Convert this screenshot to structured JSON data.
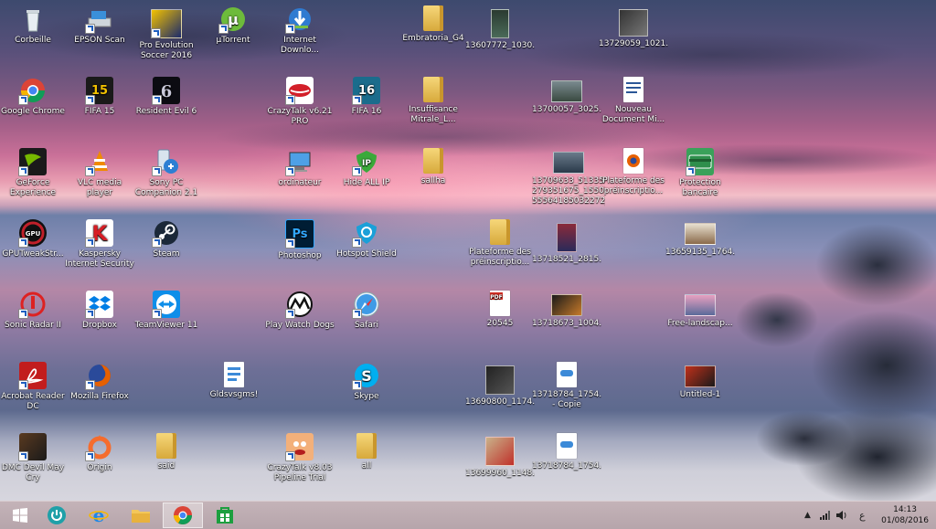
{
  "desktop": {
    "icons": {
      "recycle_bin": "Corbeille",
      "epson_scan": "EPSON Scan",
      "pes_2016": "Pro Evolution Soccer 2016",
      "utorrent": "µTorrent",
      "internet_download": "Internet Downlo...",
      "embratoria": "Embratoria_G4",
      "img_13607772": "13607772_1030...",
      "img_13729059": "13729059_1021...",
      "google_chrome": "Google Chrome",
      "fifa15": "FIFA 15",
      "resident_evil_6": "Resident Evil 6",
      "crazytalk_621": "CrazyTalk v6.21 PRO",
      "fifa16": "FIFA 16",
      "insuffisance": "Insuffisance Mitrale_L...",
      "img_13700057": "13700057_3025...",
      "nouveau_doc": "Nouveau Document Mi...",
      "geforce": "GeForce Experience",
      "vlc": "VLC media player",
      "sony_pc": "Sony PC Companion 2.1",
      "ordinateur": "ordinateur",
      "hide_all_ip": "Hide ALL IP",
      "sallha": "sallha",
      "img_13709633": "13709633_513358 279351675_15509 55564185032272_n",
      "plateforme_ff": "Plateforme des préinscriptio...",
      "protection_bancaire": "Protection bancaire",
      "gputweak": "GPUTweakStr...",
      "kaspersky": "Kaspersky Internet Security",
      "steam": "Steam",
      "photoshop": "Photoshop",
      "hotspot_shield": "Hotspot Shield",
      "plateforme_folder": "Plateforme des préinscriptio...",
      "img_13718521": "13718521_2815...",
      "img_13659135": "13659135_1764...",
      "sonic_radar": "Sonic Radar II",
      "dropbox": "Dropbox",
      "teamviewer": "TeamViewer 11",
      "play_watch_dogs": "Play Watch Dogs",
      "safari": "Safari",
      "pdf_20545": "20545",
      "img_13718673": "13718673_1004...",
      "free_landscape": "Free-landscap...",
      "acrobat": "Acrobat Reader DC",
      "firefox": "Mozilla Firefox",
      "gldsvsgms": "Gldsvsgms!",
      "skype": "Skype",
      "img_13690800": "13690800_1174...",
      "img_13718784_copie": "13718784_1754... - Copie",
      "untitled1": "Untitled-1",
      "dmc": "DMC Devil May Cry",
      "origin": "Origin",
      "said": "said",
      "crazytalk_803": "CrazyTalk v8.03 Pipeline Trial",
      "all": "all",
      "img_13699960": "13699960_1148...",
      "img_13718784": "13718784_1754..."
    }
  },
  "taskbar": {
    "tray_lang": "ع",
    "time": "14:13",
    "date": "01/08/2016"
  },
  "colors": {
    "taskbar": "#bfadb2",
    "chrome_red": "#db4437",
    "windows_blue": "#1e88e5"
  }
}
